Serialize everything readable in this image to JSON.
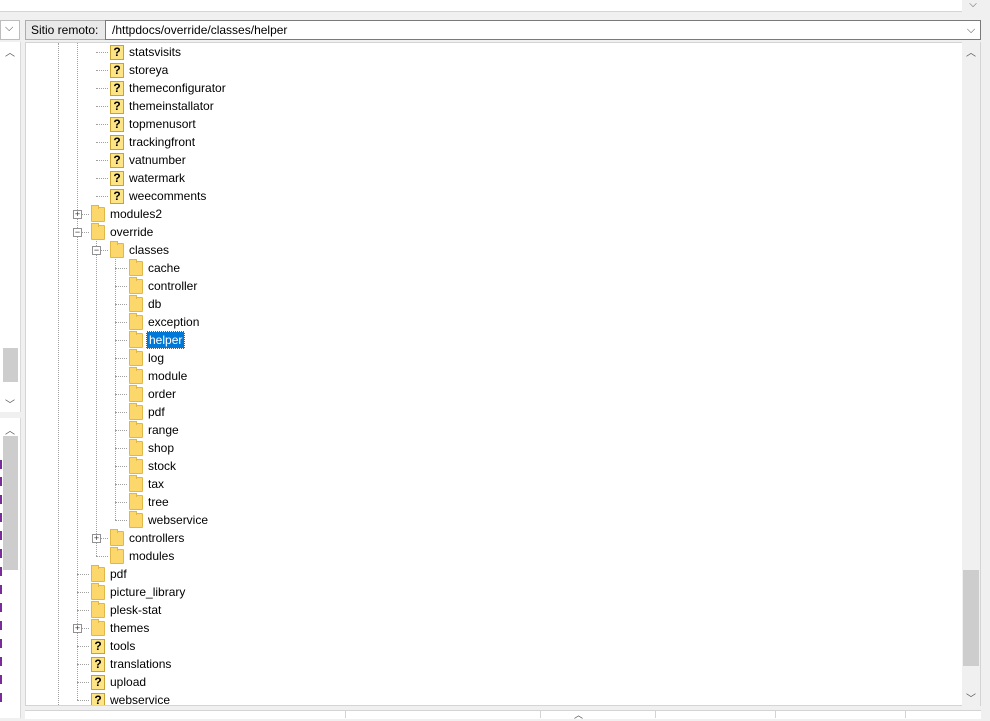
{
  "remote_site": {
    "label": "Sitio remoto:",
    "path": "/httpdocs/override/classes/helper"
  },
  "icons": {
    "scroll_up": "▲",
    "scroll_down": "▼",
    "dropdown": "chevron-down-icon",
    "folder": "folder-icon",
    "unknown": "question-icon"
  },
  "glyphs": {
    "chevron": "⌵",
    "plus": "+",
    "minus": "−",
    "question": "?",
    "up": "︿",
    "down": "﹀"
  },
  "tree": {
    "items": [
      {
        "label": "statsvisits",
        "icon": "unknown",
        "depth": 2
      },
      {
        "label": "storeya",
        "icon": "unknown",
        "depth": 2
      },
      {
        "label": "themeconfigurator",
        "icon": "unknown",
        "depth": 2
      },
      {
        "label": "themeinstallator",
        "icon": "unknown",
        "depth": 2
      },
      {
        "label": "topmenusort",
        "icon": "unknown",
        "depth": 2
      },
      {
        "label": "trackingfront",
        "icon": "unknown",
        "depth": 2
      },
      {
        "label": "vatnumber",
        "icon": "unknown",
        "depth": 2
      },
      {
        "label": "watermark",
        "icon": "unknown",
        "depth": 2
      },
      {
        "label": "weecomments",
        "icon": "unknown",
        "depth": 2
      },
      {
        "label": "modules2",
        "icon": "folder",
        "depth": 1,
        "expander": "plus"
      },
      {
        "label": "override",
        "icon": "folder",
        "depth": 1,
        "expander": "minus"
      },
      {
        "label": "classes",
        "icon": "folder",
        "depth": 2,
        "expander": "minus"
      },
      {
        "label": "cache",
        "icon": "folder",
        "depth": 3
      },
      {
        "label": "controller",
        "icon": "folder",
        "depth": 3
      },
      {
        "label": "db",
        "icon": "folder",
        "depth": 3
      },
      {
        "label": "exception",
        "icon": "folder",
        "depth": 3
      },
      {
        "label": "helper",
        "icon": "folder",
        "depth": 3,
        "selected": true
      },
      {
        "label": "log",
        "icon": "folder",
        "depth": 3
      },
      {
        "label": "module",
        "icon": "folder",
        "depth": 3
      },
      {
        "label": "order",
        "icon": "folder",
        "depth": 3
      },
      {
        "label": "pdf",
        "icon": "folder",
        "depth": 3
      },
      {
        "label": "range",
        "icon": "folder",
        "depth": 3
      },
      {
        "label": "shop",
        "icon": "folder",
        "depth": 3
      },
      {
        "label": "stock",
        "icon": "folder",
        "depth": 3
      },
      {
        "label": "tax",
        "icon": "folder",
        "depth": 3
      },
      {
        "label": "tree",
        "icon": "folder",
        "depth": 3
      },
      {
        "label": "webservice",
        "icon": "folder",
        "depth": 3
      },
      {
        "label": "controllers",
        "icon": "folder",
        "depth": 2,
        "expander": "plus"
      },
      {
        "label": "modules",
        "icon": "folder",
        "depth": 2
      },
      {
        "label": "pdf",
        "icon": "folder",
        "depth": 1
      },
      {
        "label": "picture_library",
        "icon": "folder",
        "depth": 1
      },
      {
        "label": "plesk-stat",
        "icon": "folder",
        "depth": 1
      },
      {
        "label": "themes",
        "icon": "folder",
        "depth": 1,
        "expander": "plus"
      },
      {
        "label": "tools",
        "icon": "unknown",
        "depth": 1
      },
      {
        "label": "translations",
        "icon": "unknown",
        "depth": 1
      },
      {
        "label": "upload",
        "icon": "unknown",
        "depth": 1
      },
      {
        "label": "webservice",
        "icon": "unknown",
        "depth": 1
      }
    ]
  },
  "colors": {
    "selection": "#0078d7",
    "folder": "#fcd76b",
    "unknown": "#fde486"
  }
}
